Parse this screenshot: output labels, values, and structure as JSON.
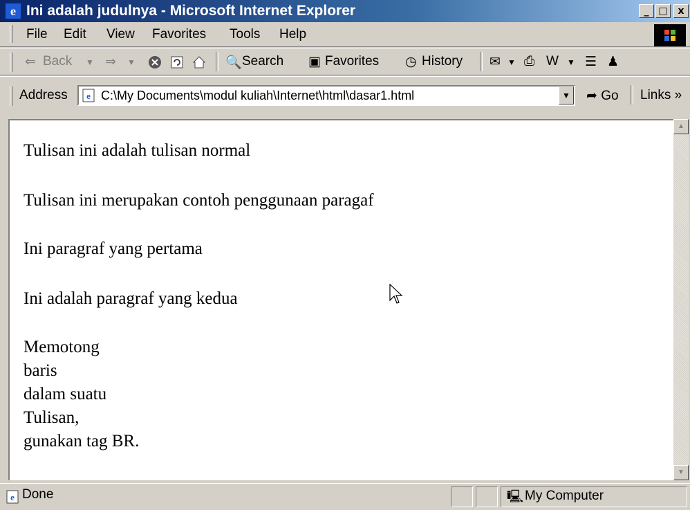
{
  "window": {
    "title": "Ini adalah judulnya - Microsoft Internet Explorer",
    "min_label": "_",
    "max_label": "□",
    "close_label": "x"
  },
  "menu": [
    "File",
    "Edit",
    "View",
    "Favorites",
    "Tools",
    "Help"
  ],
  "toolbar": {
    "back_label": "Back",
    "search_label": "Search",
    "favorites_label": "Favorites",
    "history_label": "History"
  },
  "address": {
    "label": "Address",
    "value": "C:\\My Documents\\modul kuliah\\Internet\\html\\dasar1.html",
    "go_label": "Go",
    "links_label": "Links",
    "links_more": "»"
  },
  "content": {
    "lines": [
      "Tulisan ini adalah tulisan normal",
      "Tulisan ini merupakan contoh penggunaan paragaf",
      "Ini paragraf yang pertama",
      "Ini adalah paragraf yang kedua",
      "Memotong",
      "baris",
      "dalam suatu",
      "Tulisan,",
      "gunakan tag BR."
    ]
  },
  "status": {
    "text": "Done",
    "zone": "My Computer"
  },
  "colors": {
    "titlebar_start": "#0a246a",
    "titlebar_end": "#a6caf0",
    "chrome": "#d4d0c8"
  }
}
